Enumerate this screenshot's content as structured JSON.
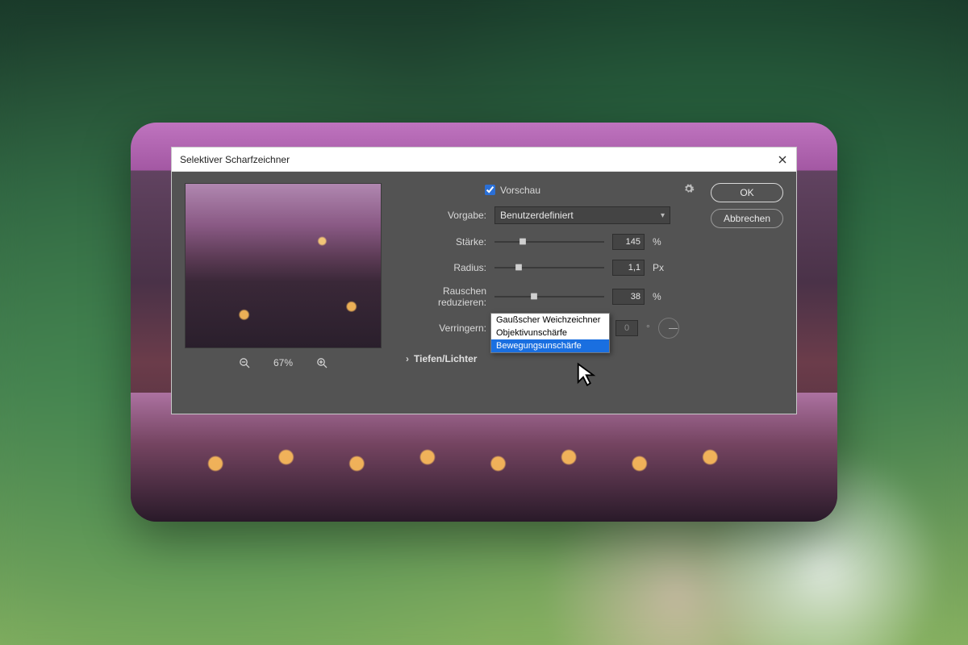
{
  "window": {
    "title": "Selektiver Scharfzeichner"
  },
  "preview": {
    "checkbox_label": "Vorschau",
    "checked": true,
    "zoom": "67%"
  },
  "buttons": {
    "ok": "OK",
    "cancel": "Abbrechen"
  },
  "preset": {
    "label": "Vorgabe:",
    "value": "Benutzerdefiniert"
  },
  "sliders": {
    "strength": {
      "label": "Stärke:",
      "value": "145",
      "unit": "%",
      "pos": 26
    },
    "radius": {
      "label": "Radius:",
      "value": "1,1",
      "unit": "Px",
      "pos": 22
    },
    "noise": {
      "label": "Rauschen reduzieren:",
      "value": "38",
      "unit": "%",
      "pos": 36
    }
  },
  "reduce": {
    "label": "Verringern:",
    "value": "Objektivunschärfe",
    "angle_value": "0",
    "options": [
      "Gaußscher Weichzeichner",
      "Objektivunschärfe",
      "Bewegungsunschärfe"
    ],
    "highlighted": "Bewegungsunschärfe"
  },
  "section": {
    "shadows_highlights": "Tiefen/Lichter"
  }
}
